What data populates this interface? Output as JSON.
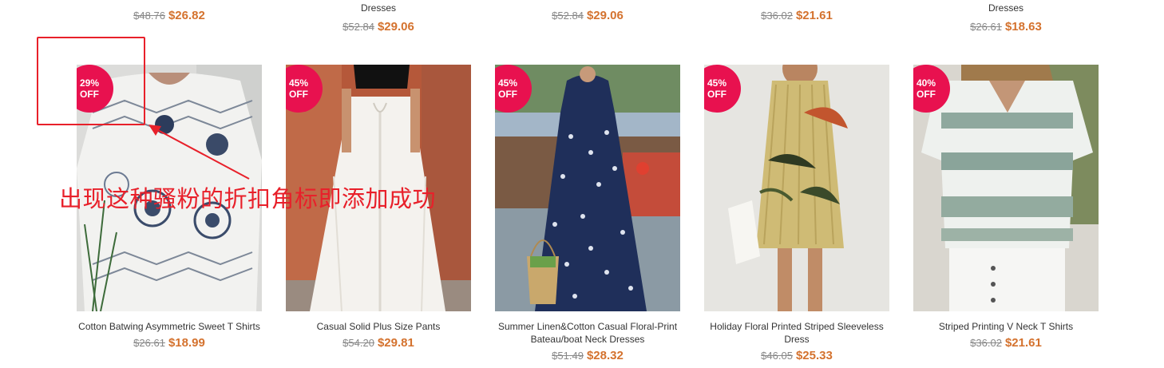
{
  "top_row": [
    {
      "name": "",
      "old_price": "$48.76",
      "new_price": "$26.82"
    },
    {
      "name": "Dresses",
      "old_price": "$52.84",
      "new_price": "$29.06"
    },
    {
      "name": "",
      "old_price": "$52.84",
      "new_price": "$29.06"
    },
    {
      "name": "",
      "old_price": "$36.02",
      "new_price": "$21.61"
    },
    {
      "name": "Dresses",
      "old_price": "$26.61",
      "new_price": "$18.63"
    }
  ],
  "products": [
    {
      "badge_pct": "29%",
      "badge_off": "OFF",
      "name": "Cotton Batwing Asymmetric Sweet T Shirts",
      "old_price": "$26.61",
      "new_price": "$18.99",
      "image": "white-patterned-tshirt"
    },
    {
      "badge_pct": "45%",
      "badge_off": "OFF",
      "name": "Casual Solid Plus Size Pants",
      "old_price": "$54.20",
      "new_price": "$29.81",
      "image": "white-wide-pants"
    },
    {
      "badge_pct": "45%",
      "badge_off": "OFF",
      "name": "Summer Linen&Cotton Casual Floral-Print Bateau/boat Neck Dresses",
      "old_price": "$51.49",
      "new_price": "$28.32",
      "image": "navy-floral-dress"
    },
    {
      "badge_pct": "45%",
      "badge_off": "OFF",
      "name": "Holiday Floral Printed Striped Sleeveless Dress",
      "old_price": "$46.05",
      "new_price": "$25.33",
      "image": "palm-print-dress"
    },
    {
      "badge_pct": "40%",
      "badge_off": "OFF",
      "name": "Striped Printing V Neck T Shirts",
      "old_price": "$36.02",
      "new_price": "$21.61",
      "image": "green-tiedye-tshirt"
    }
  ],
  "annotation": {
    "text": "出现这种骚粉的折扣角标即添加成功",
    "color": "#e8202a"
  },
  "colors": {
    "badge": "#e8114f",
    "price": "#d4722e",
    "old_price": "#888888"
  }
}
